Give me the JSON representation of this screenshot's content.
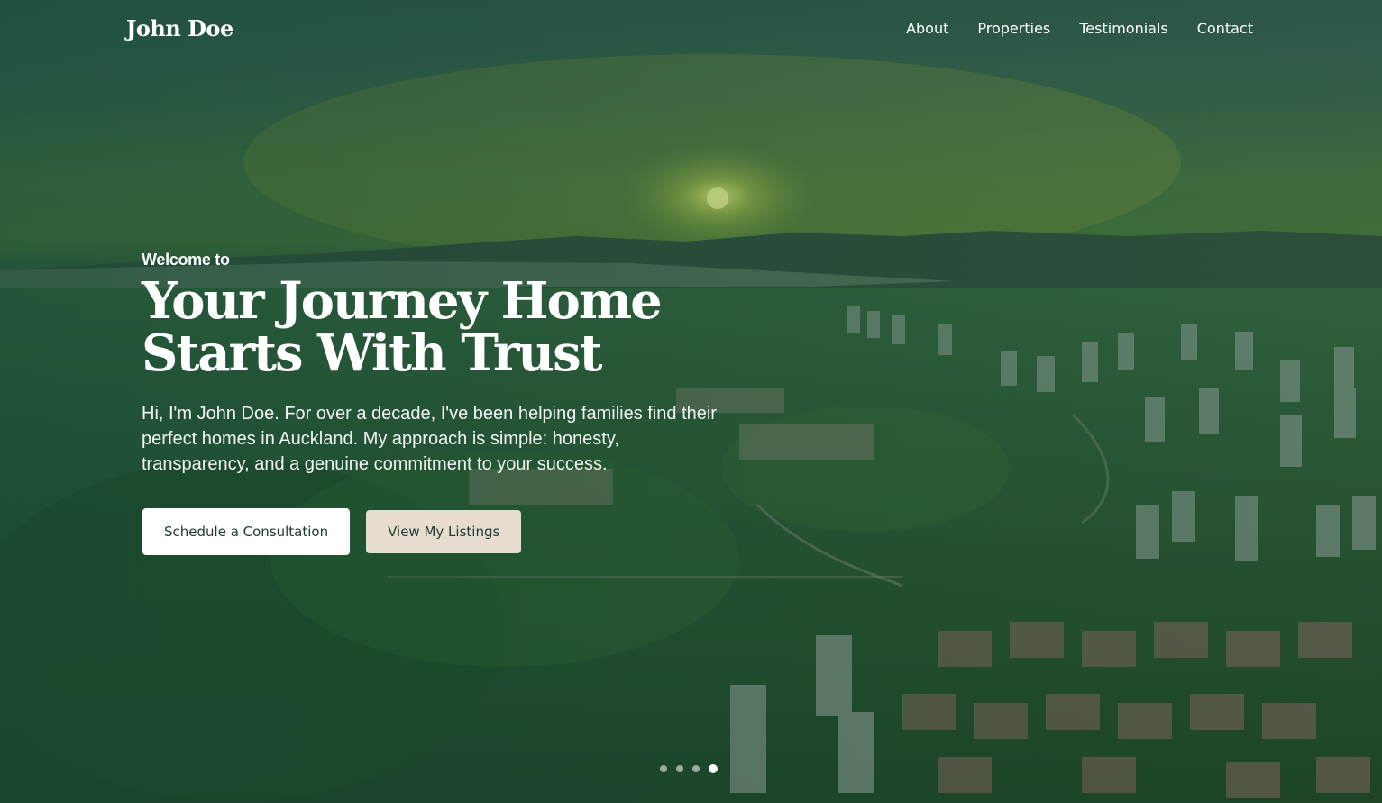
{
  "nav": {
    "logo": "John Doe",
    "links": [
      "About",
      "Properties",
      "Testimonials",
      "Contact"
    ]
  },
  "hero": {
    "eyebrow": "Welcome to",
    "headline_line1": "Your Journey Home",
    "headline_line2": "Starts With Trust",
    "intro": "Hi, I'm John Doe. For over a decade, I've been helping families find their perfect homes in Auckland. My approach is simple: honesty, transparency, and a genuine commitment to your success.",
    "primary_button": "Schedule a Consultation",
    "secondary_button": "View My Listings",
    "carousel": {
      "slide_count": 4,
      "active_slide": 4
    }
  },
  "colors": {
    "overlay": "#1f5a45",
    "button_primary_bg": "#ffffff",
    "button_secondary_bg": "#e6ddd0",
    "button_text": "#1e3b30"
  }
}
